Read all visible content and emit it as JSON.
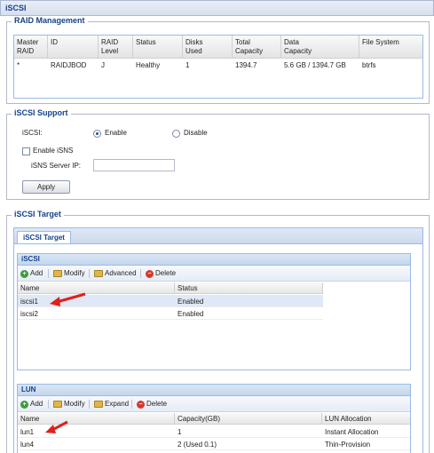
{
  "page": {
    "title": "iSCSI"
  },
  "raid": {
    "legend": "RAID Management",
    "columns": [
      {
        "line1": "Master",
        "line2": "RAID"
      },
      {
        "line1": "ID",
        "line2": ""
      },
      {
        "line1": "RAID",
        "line2": "Level"
      },
      {
        "line1": "Status",
        "line2": ""
      },
      {
        "line1": "Disks",
        "line2": "Used"
      },
      {
        "line1": "Total",
        "line2": "Capacity"
      },
      {
        "line1": "Data",
        "line2": "Capacity"
      },
      {
        "line1": "File System",
        "line2": ""
      }
    ],
    "rows": [
      [
        "*",
        "RAIDJBOD",
        "J",
        "Healthy",
        "1",
        "1394.7",
        "5.6 GB / 1394.7 GB",
        "btrfs"
      ]
    ]
  },
  "support": {
    "legend": "iSCSI Support",
    "iscsi_label": "iSCSI:",
    "enable_label": "Enable",
    "disable_label": "Disable",
    "selected": "enable",
    "isns_label": "Enable iSNS",
    "isns_checked": false,
    "isns_ip_label": "iSNS Server IP:",
    "isns_ip_value": "",
    "apply_label": "Apply"
  },
  "target": {
    "legend": "iSCSI Target",
    "tab_label": "iSCSI Target",
    "iscsi_panel": {
      "title": "iSCSI",
      "toolbar": [
        "Add",
        "Modify",
        "Advanced",
        "Delete"
      ],
      "columns": [
        "Name",
        "Status"
      ],
      "rows": [
        {
          "name": "iscsi1",
          "status": "Enabled",
          "selected": true
        },
        {
          "name": "iscsi2",
          "status": "Enabled",
          "selected": false
        }
      ]
    },
    "lun_panel": {
      "title": "LUN",
      "toolbar": [
        "Add",
        "Modify",
        "Expand",
        "Delete"
      ],
      "columns": [
        "Name",
        "Capacity(GB)",
        "LUN Allocation"
      ],
      "rows": [
        {
          "name": "lun1",
          "capacity": "1",
          "allocation": "Instant Allocation"
        },
        {
          "name": "lun4",
          "capacity": "2 (Used 0.1)",
          "allocation": "Thin-Provision"
        }
      ]
    }
  },
  "colors": {
    "accent": "#15428b",
    "border": "#99bbe8",
    "arrow": "#e0201a",
    "selected_row": "#dfe8f6"
  }
}
